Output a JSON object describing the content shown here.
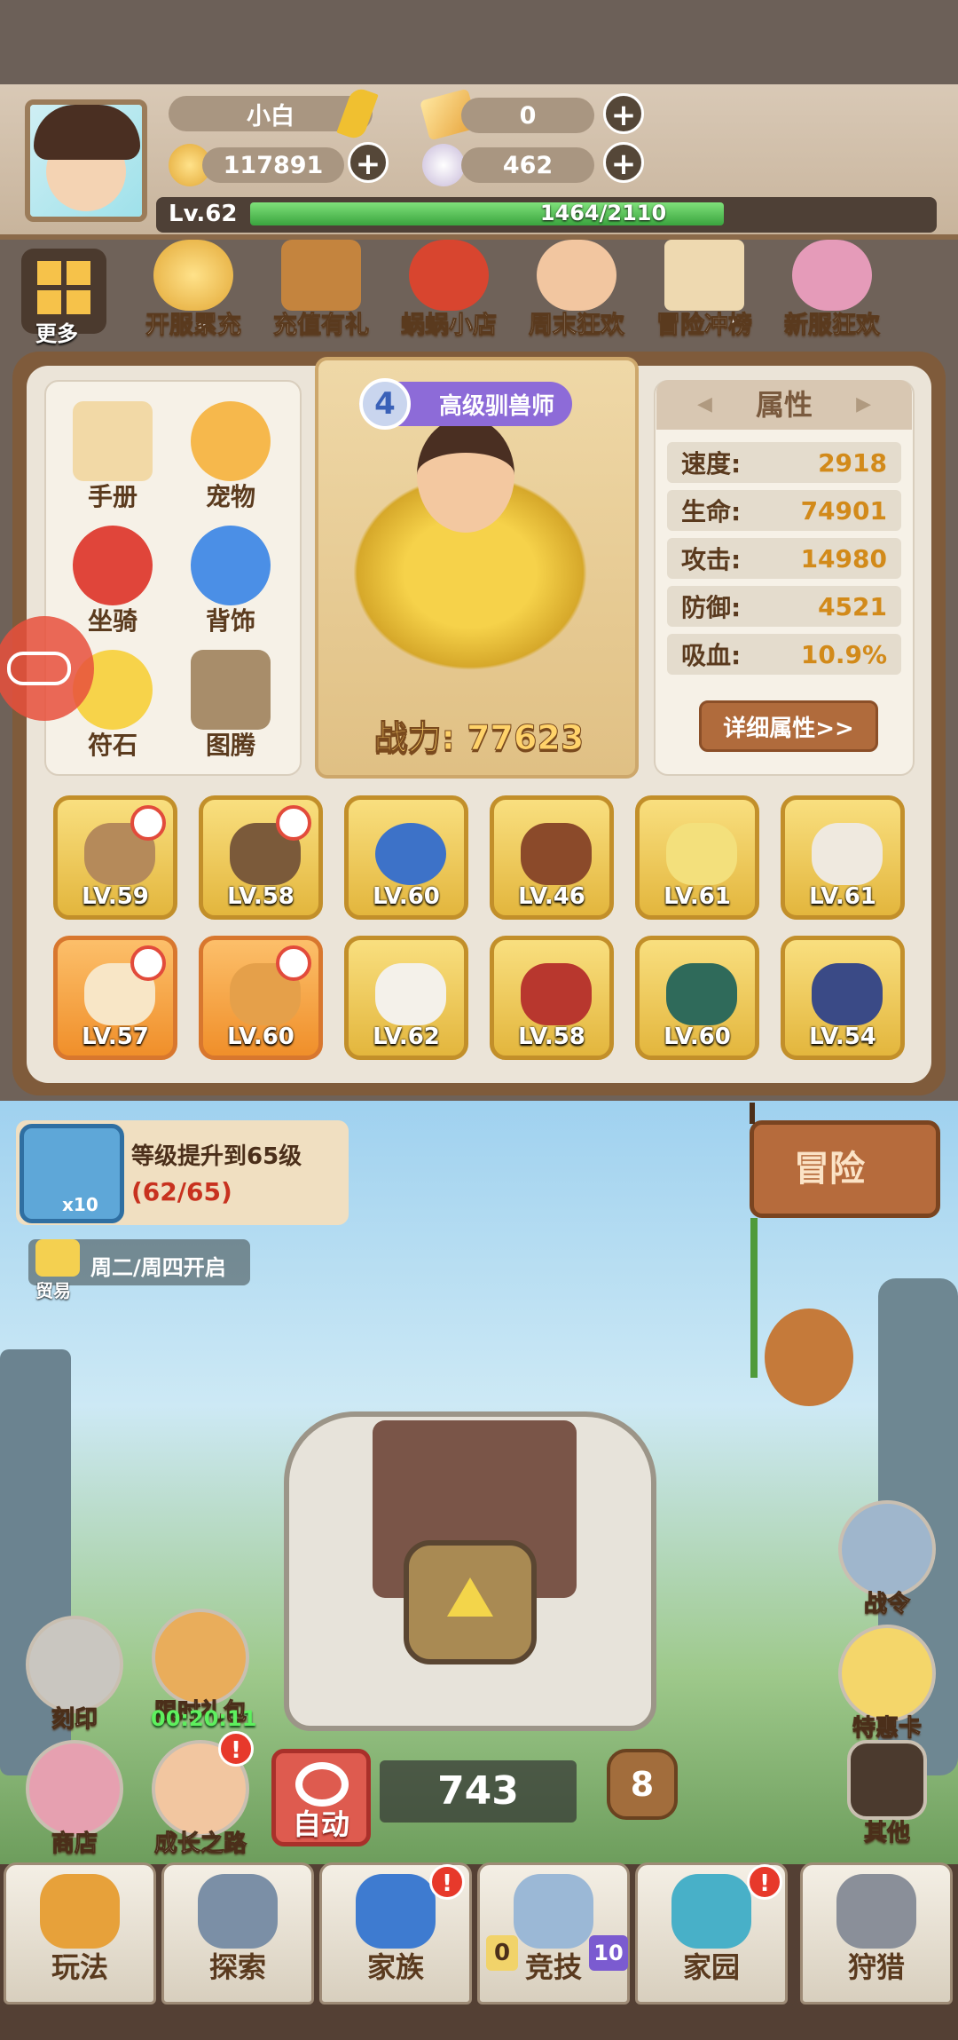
{
  "player": {
    "name": "小白",
    "level": "Lv.62",
    "exp_text": "1464/2110",
    "exp_ratio": 0.693
  },
  "currencies": {
    "tickets": "0",
    "coins": "117891",
    "shells": "462"
  },
  "events": [
    {
      "label": "开服累充"
    },
    {
      "label": "充值有礼"
    },
    {
      "label": "蜗蜗小店"
    },
    {
      "label": "周末狂欢"
    },
    {
      "label": "冒险冲榜"
    },
    {
      "label": "新服狂欢"
    }
  ],
  "more_label": "更多",
  "left_menu": [
    {
      "label": "手册"
    },
    {
      "label": "宠物"
    },
    {
      "label": "坐骑"
    },
    {
      "label": "背饰"
    },
    {
      "label": "符石"
    },
    {
      "label": "图腾"
    }
  ],
  "hero": {
    "rank_badge": "4",
    "title": "高级驯兽师",
    "power": "战力: 77623"
  },
  "attributes": {
    "header": "属性",
    "rows": [
      {
        "key": "速度:",
        "value": "2918"
      },
      {
        "key": "生命:",
        "value": "74901"
      },
      {
        "key": "攻击:",
        "value": "14980"
      },
      {
        "key": "防御:",
        "value": "4521"
      },
      {
        "key": "吸血:",
        "value": "10.9%"
      }
    ],
    "detail_button": "详细属性>>"
  },
  "gear": [
    {
      "level": "LV.59"
    },
    {
      "level": "LV.58"
    },
    {
      "level": "LV.60"
    },
    {
      "level": "LV.46"
    },
    {
      "level": "LV.61"
    },
    {
      "level": "LV.61"
    },
    {
      "level": "LV.57"
    },
    {
      "level": "LV.60"
    },
    {
      "level": "LV.62"
    },
    {
      "level": "LV.58"
    },
    {
      "level": "LV.60"
    },
    {
      "level": "LV.54"
    }
  ],
  "quest": {
    "title": "等级提升到65级",
    "progress": "(62/65)",
    "reward_count": "x10"
  },
  "trade": {
    "label": "贸易",
    "schedule": "周二/周四开启"
  },
  "adventure_button": "冒险",
  "side_right": [
    {
      "label": "战令"
    },
    {
      "label": "特惠卡"
    },
    {
      "label": "其他"
    }
  ],
  "side_left": [
    {
      "label": "刻印"
    },
    {
      "label": "限时礼包"
    },
    {
      "label": "商店"
    },
    {
      "label": "成长之路"
    }
  ],
  "gift_timer": "00:20:11",
  "auto_label": "自动",
  "chest_count": "743",
  "chest_level": "8",
  "alert_mark": "!",
  "bottom_nav": [
    {
      "label": "玩法"
    },
    {
      "label": "探索"
    },
    {
      "label": "家族"
    },
    {
      "label": "竞技"
    },
    {
      "label": "家园"
    },
    {
      "label": "狩猎"
    }
  ],
  "arena_badges": {
    "left": "0",
    "right": "10"
  }
}
